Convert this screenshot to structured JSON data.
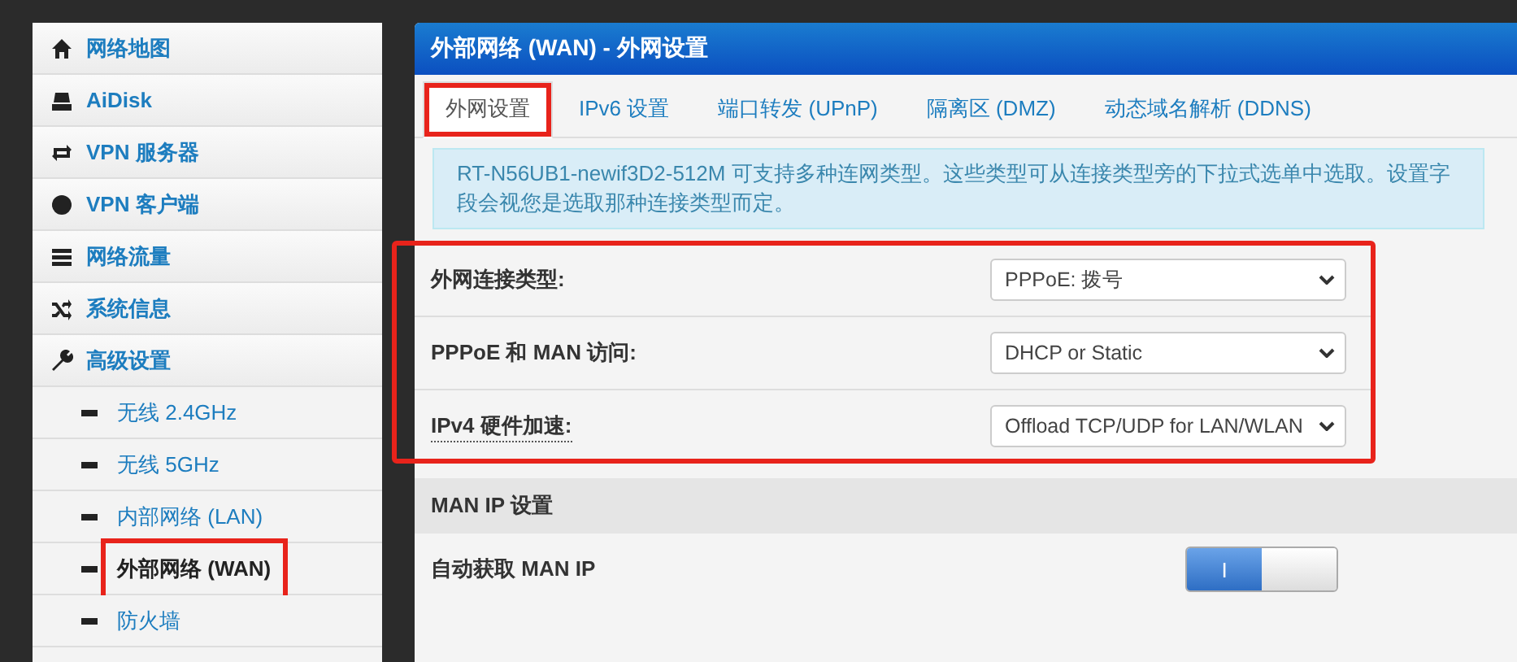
{
  "sidebar": {
    "items": [
      {
        "label": "网络地图",
        "selected": false,
        "highlighted": false
      },
      {
        "label": "AiDisk",
        "selected": false,
        "highlighted": false
      },
      {
        "label": "VPN 服务器",
        "selected": false,
        "highlighted": false
      },
      {
        "label": "VPN 客户端",
        "selected": false,
        "highlighted": false
      },
      {
        "label": "网络流量",
        "selected": false,
        "highlighted": false
      },
      {
        "label": "系统信息",
        "selected": false,
        "highlighted": false
      },
      {
        "label": "高级设置",
        "selected": false,
        "highlighted": false,
        "children": [
          {
            "label": "无线 2.4GHz",
            "selected": false,
            "highlighted": false
          },
          {
            "label": "无线 5GHz",
            "selected": false,
            "highlighted": false
          },
          {
            "label": "内部网络 (LAN)",
            "selected": false,
            "highlighted": false
          },
          {
            "label": "外部网络 (WAN)",
            "selected": true,
            "highlighted": true
          },
          {
            "label": "防火墙",
            "selected": false,
            "highlighted": false
          }
        ]
      }
    ]
  },
  "panel": {
    "title": "外部网络 (WAN) - 外网设置",
    "tabs": [
      {
        "label": "外网设置",
        "selected": true,
        "highlighted": true
      },
      {
        "label": "IPv6 设置",
        "selected": false,
        "highlighted": false
      },
      {
        "label": "端口转发 (UPnP)",
        "selected": false,
        "highlighted": false
      },
      {
        "label": "隔离区 (DMZ)",
        "selected": false,
        "highlighted": false
      },
      {
        "label": "动态域名解析 (DDNS)",
        "selected": false,
        "highlighted": false
      }
    ],
    "info": "RT-N56UB1-newif3D2-512M 可支持多种连网类型。这些类型可从连接类型旁的下拉式选单中选取。设置字段会视您是选取那种连接类型而定。",
    "form": {
      "highlighted": true,
      "fields": [
        {
          "label": "外网连接类型:",
          "value": "PPPoE: 拨号",
          "hint": false
        },
        {
          "label": "PPPoE 和 MAN 访问:",
          "value": "DHCP or Static",
          "hint": false
        },
        {
          "label": "IPv4 硬件加速:",
          "value": "Offload TCP/UDP for LAN/WLAN",
          "hint": true
        }
      ]
    },
    "section": {
      "title": "MAN IP 设置",
      "rows": [
        {
          "label": "自动获取 MAN IP",
          "toggle": {
            "on": true,
            "label": "I"
          }
        }
      ]
    }
  }
}
